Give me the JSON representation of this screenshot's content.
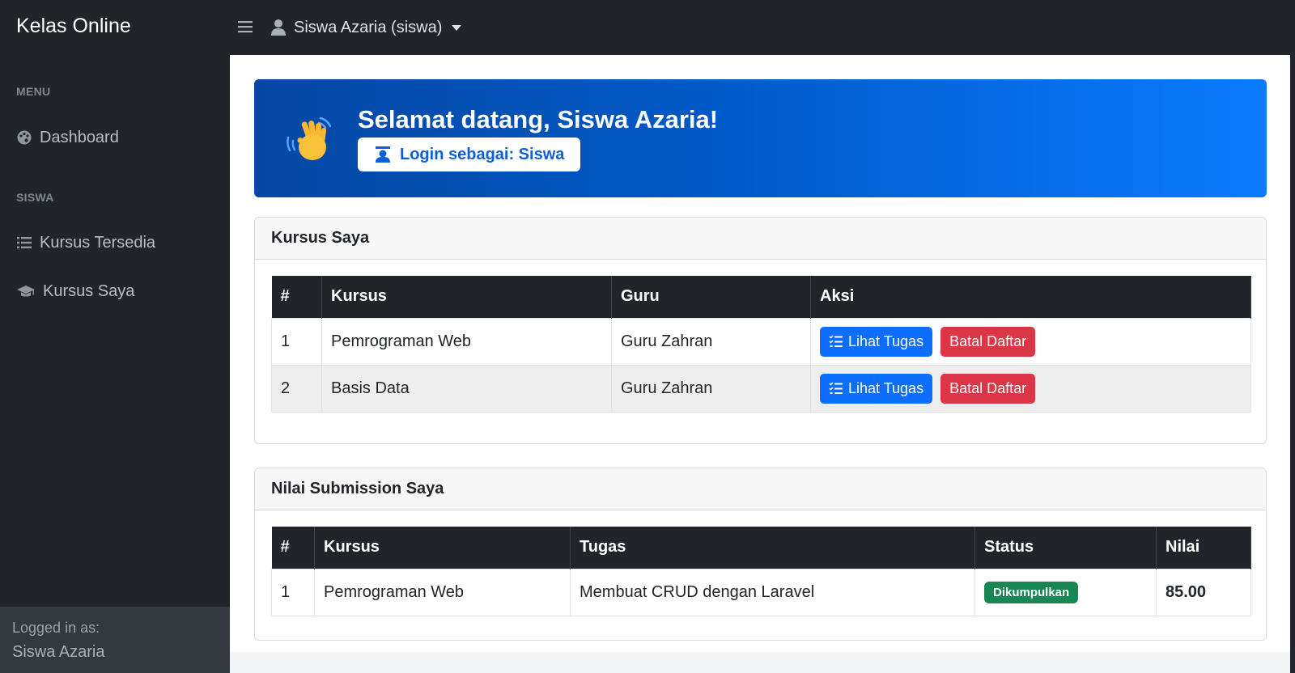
{
  "app": {
    "brand": "Kelas Online"
  },
  "header": {
    "user_label": "Siswa Azaria (siswa)"
  },
  "sidebar": {
    "sections": [
      {
        "label": "MENU",
        "items": [
          {
            "label": "Dashboard",
            "icon": "palette-icon"
          }
        ]
      },
      {
        "label": "SISWA",
        "items": [
          {
            "label": "Kursus Tersedia",
            "icon": "list-icon"
          },
          {
            "label": "Kursus Saya",
            "icon": "graduation-cap-icon"
          }
        ]
      }
    ],
    "footer": {
      "label": "Logged in as:",
      "name": "Siswa Azaria"
    }
  },
  "hero": {
    "title": "Selamat datang, Siswa Azaria!",
    "badge": "Login sebagai: Siswa",
    "icon": "waving-hand-icon"
  },
  "courses": {
    "title": "Kursus Saya",
    "columns": [
      "#",
      "Kursus",
      "Guru",
      "Aksi"
    ],
    "rows": [
      {
        "no": "1",
        "course": "Pemrograman Web",
        "teacher": "Guru Zahran",
        "view_label": "Lihat Tugas",
        "cancel_label": "Batal Daftar"
      },
      {
        "no": "2",
        "course": "Basis Data",
        "teacher": "Guru Zahran",
        "view_label": "Lihat Tugas",
        "cancel_label": "Batal Daftar"
      }
    ]
  },
  "grades": {
    "title": "Nilai Submission Saya",
    "columns": [
      "#",
      "Kursus",
      "Tugas",
      "Status",
      "Nilai"
    ],
    "rows": [
      {
        "no": "1",
        "course": "Pemrograman Web",
        "task": "Membuat CRUD dengan Laravel",
        "status": "Dikumpulkan",
        "score": "85.00"
      }
    ]
  },
  "colors": {
    "dark": "#212529",
    "primary": "#0d6efd",
    "danger": "#dc3545",
    "success": "#198754",
    "hero_start": "#0647a3",
    "hero_end": "#0c7bff"
  }
}
